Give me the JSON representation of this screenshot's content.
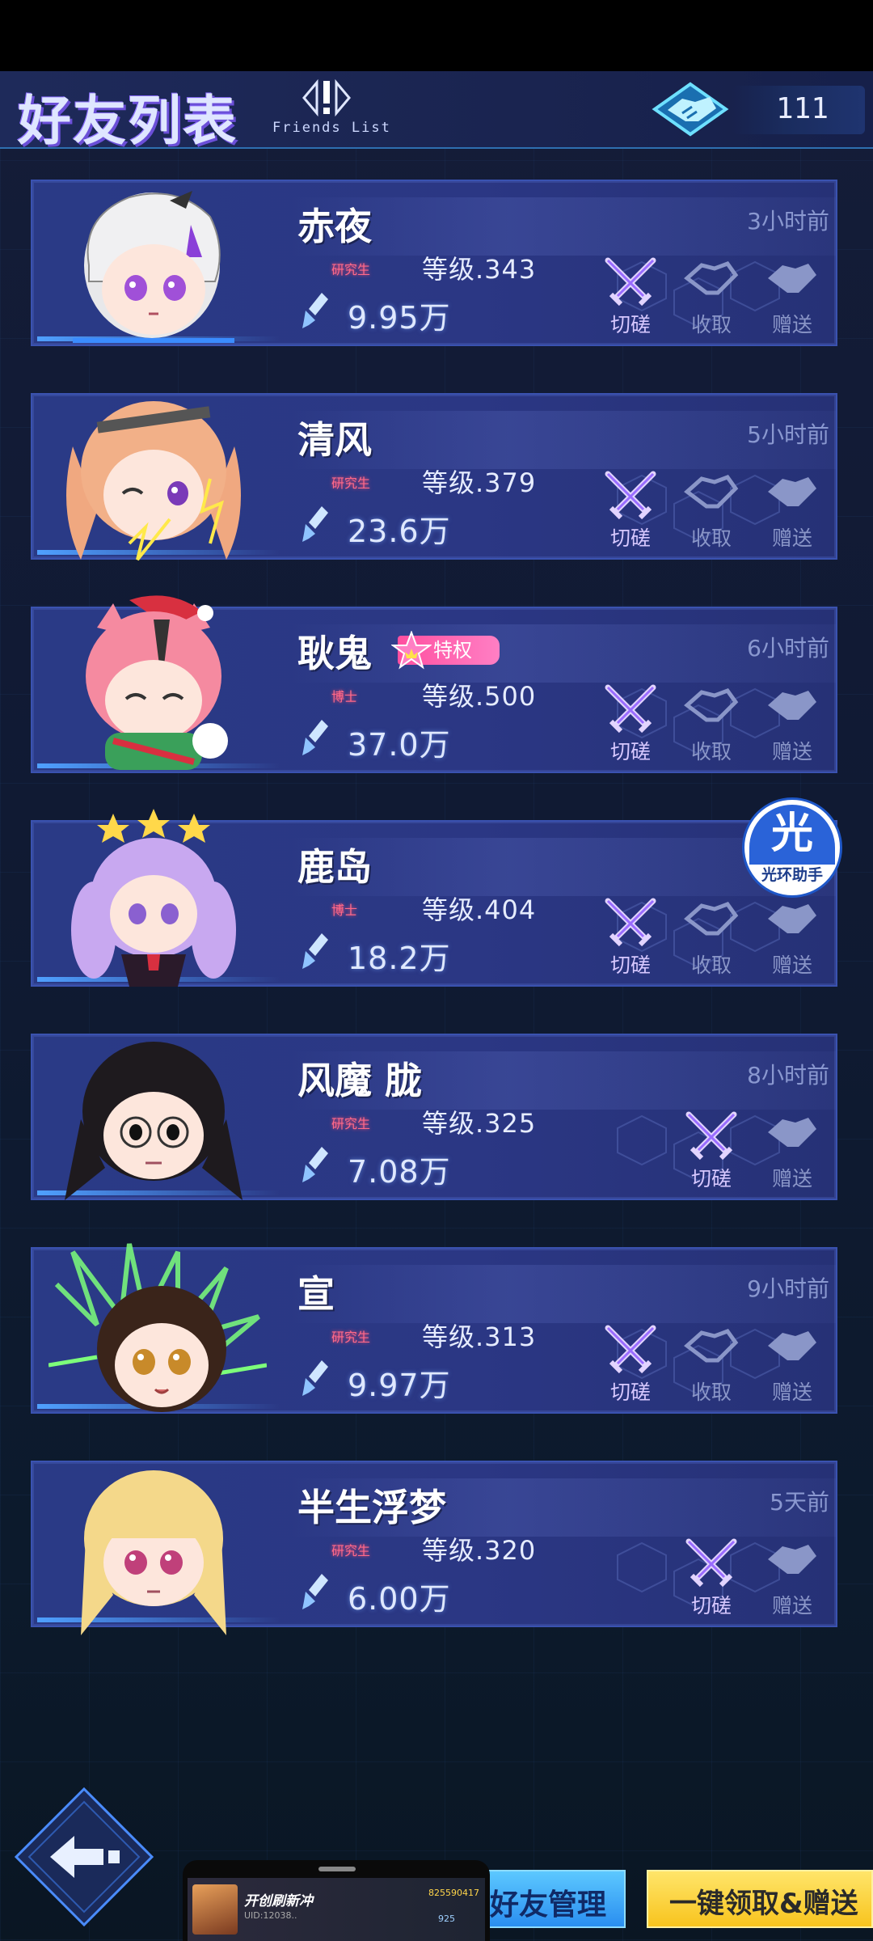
{
  "header": {
    "title_cn": "好友列表",
    "title_en": "Friends List",
    "friend_count": "111"
  },
  "friends": [
    {
      "name": "赤夜",
      "rank": "研究生",
      "level": "等级.343",
      "power": "9.95万",
      "time": "3小时前",
      "privilege": "",
      "actions": {
        "spar": "切磋",
        "receive": "收取",
        "gift": "赠送"
      }
    },
    {
      "name": "清风",
      "rank": "研究生",
      "level": "等级.379",
      "power": "23.6万",
      "time": "5小时前",
      "privilege": "",
      "actions": {
        "spar": "切磋",
        "receive": "收取",
        "gift": "赠送"
      }
    },
    {
      "name": "耿鬼",
      "rank": "博士",
      "level": "等级.500",
      "power": "37.0万",
      "time": "6小时前",
      "privilege": "特权",
      "actions": {
        "spar": "切磋",
        "receive": "收取",
        "gift": "赠送"
      }
    },
    {
      "name": "鹿岛",
      "rank": "博士",
      "level": "等级.404",
      "power": "18.2万",
      "time": "",
      "privilege": "",
      "actions": {
        "spar": "切磋",
        "receive": "收取",
        "gift": "赠送"
      }
    },
    {
      "name": "风魔 胧",
      "rank": "研究生",
      "level": "等级.325",
      "power": "7.08万",
      "time": "8小时前",
      "privilege": "",
      "actions": {
        "spar": "切磋",
        "gift": "赠送"
      }
    },
    {
      "name": "宣",
      "rank": "研究生",
      "level": "等级.313",
      "power": "9.97万",
      "time": "9小时前",
      "privilege": "",
      "actions": {
        "spar": "切磋",
        "receive": "收取",
        "gift": "赠送"
      }
    },
    {
      "name": "半生浮梦",
      "rank": "研究生",
      "level": "等级.320",
      "power": "6.00万",
      "time": "5天前",
      "privilege": "",
      "actions": {
        "spar": "切磋",
        "gift": "赠送"
      }
    }
  ],
  "assistant": {
    "glyph": "光",
    "label": "光环助手"
  },
  "bottom": {
    "manage_label": "好友管理",
    "claim_label": "一键领取&赠送"
  },
  "mini_popup": {
    "name": "开创刷新冲",
    "uid": "UID:12038..",
    "stat1": "825590417",
    "stat2": "925"
  },
  "colors": {
    "card_bg": "#2a3a86",
    "accent_blue": "#4fa0ff",
    "privilege_pink": "#ff4fa0",
    "claim_yellow": "#f8c41e",
    "manage_blue": "#2a8ef0"
  }
}
